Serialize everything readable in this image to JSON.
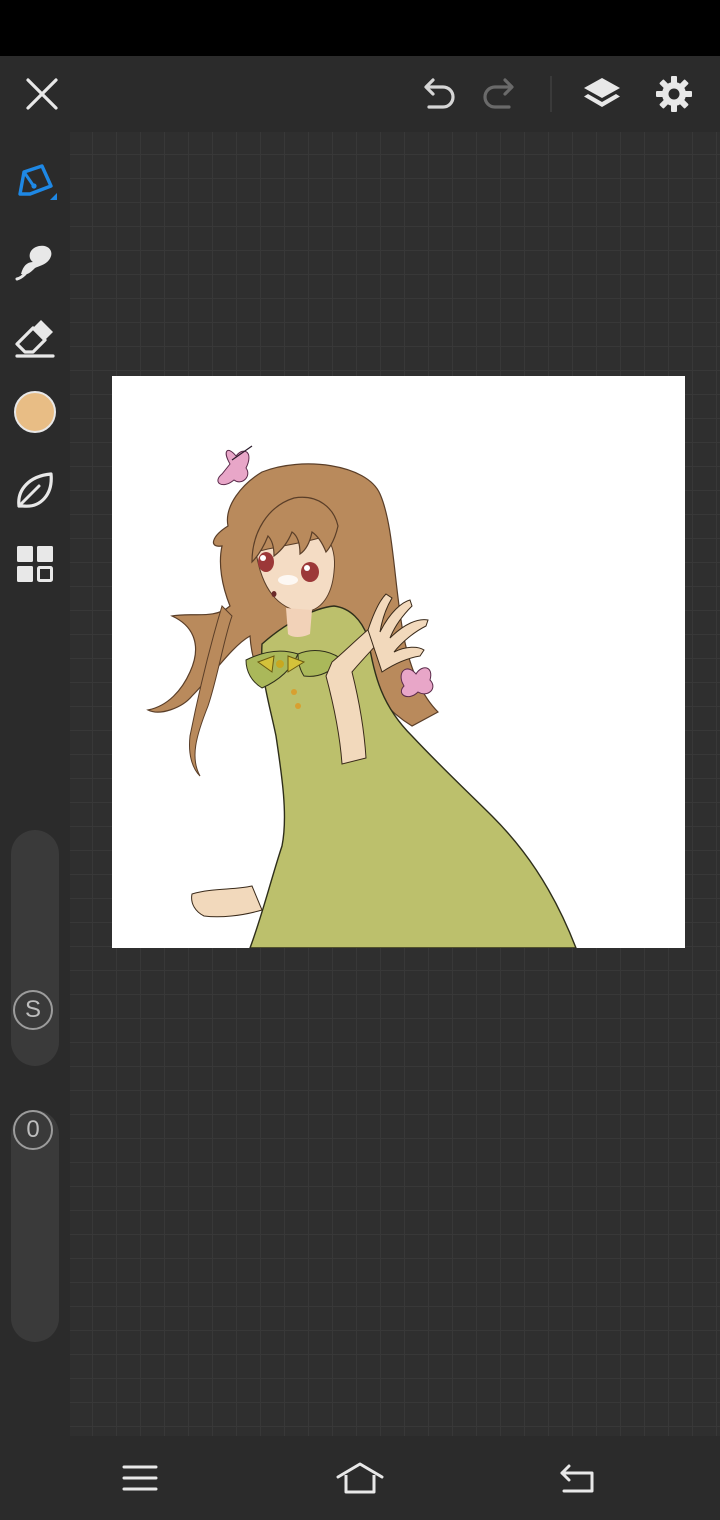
{
  "toolbar": {
    "close_icon": "close-icon",
    "undo_icon": "undo-icon",
    "redo_icon": "redo-icon",
    "layers_icon": "layers-icon",
    "settings_icon": "gear-icon"
  },
  "sidebar": {
    "tools": [
      {
        "name": "pen-tool",
        "icon": "pen-icon",
        "active": true
      },
      {
        "name": "smudge-tool",
        "icon": "smudge-icon",
        "active": false
      },
      {
        "name": "eraser-tool",
        "icon": "eraser-icon",
        "active": false
      },
      {
        "name": "color-picker",
        "icon": "color-swatch",
        "active": false
      },
      {
        "name": "shape-tool",
        "icon": "leaf-icon",
        "active": false
      },
      {
        "name": "materials-tool",
        "icon": "grid-icon",
        "active": false
      }
    ],
    "current_color": "#e8bd85",
    "size_label": "S",
    "opacity_label": "0"
  },
  "colors": {
    "accent": "#1e88e5",
    "panel": "#2b2b2b",
    "canvas_bg": "#2f2f2f",
    "icon": "#e8e8e8",
    "icon_disabled": "#6a6a6a"
  },
  "nav": {
    "menu_icon": "menu-icon",
    "home_icon": "home-icon",
    "back_icon": "back-icon"
  }
}
